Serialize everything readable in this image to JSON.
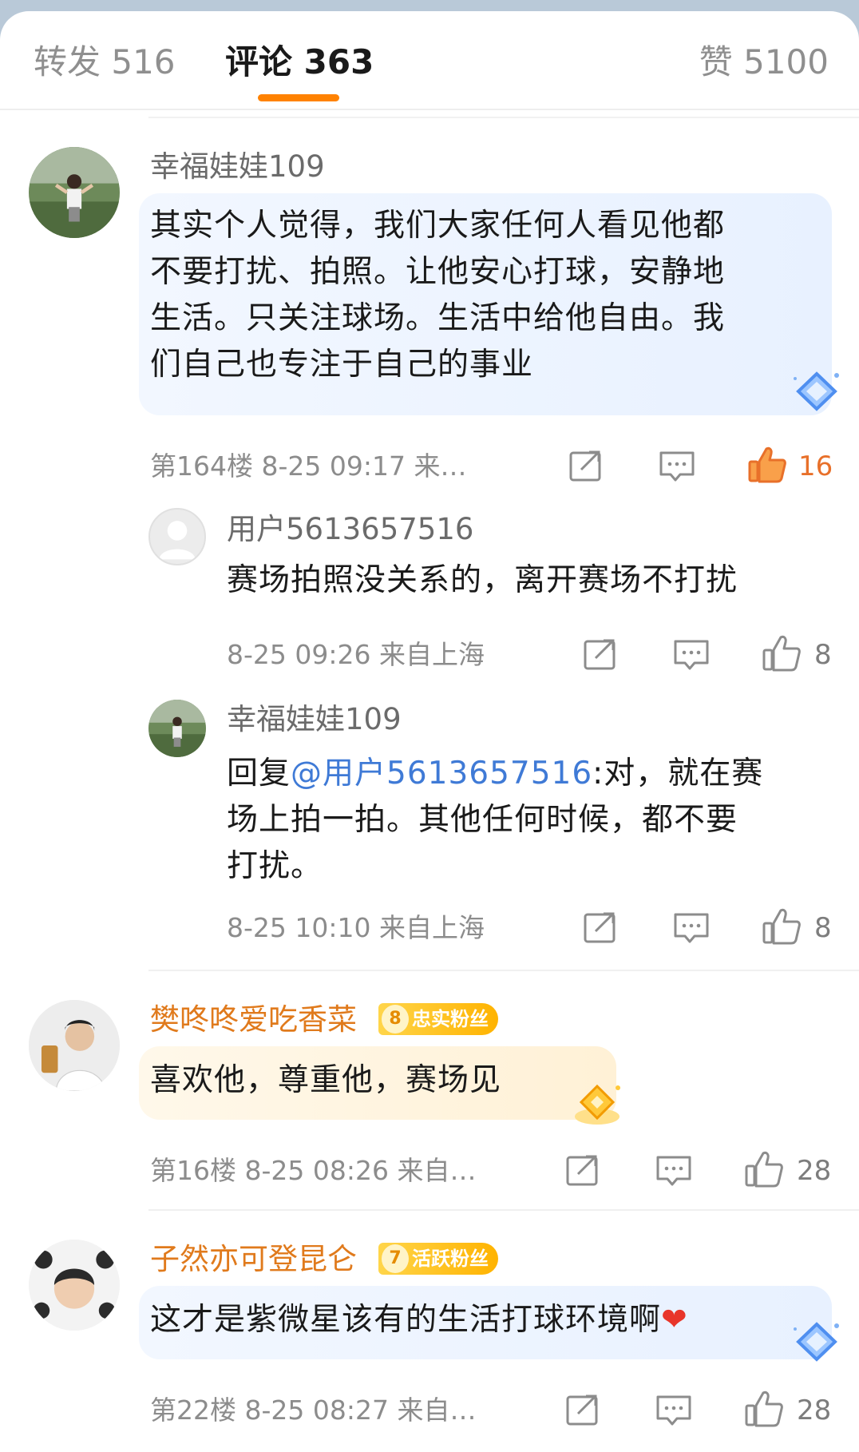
{
  "tabs": {
    "repost": "转发 516",
    "comments": "评论 363",
    "likes": "赞 5100"
  },
  "comments": [
    {
      "username": "幸福娃娃109",
      "text": [
        "其实个人觉得，我们大家任何人看见他都",
        "不要打扰、拍照。让他安心打球，安静地",
        "生活。只关注球场。生活中给他自由。我",
        "们自己也专注于自己的事业"
      ],
      "meta": "第164楼  8-25 09:17  来…",
      "likes": "16",
      "icons": [
        "share-icon",
        "comment-icon",
        "thumbs-up-icon"
      ]
    },
    {
      "username": "用户5613657516",
      "text": [
        "赛场拍照没关系的，离开赛场不打扰"
      ],
      "meta": "8-25 09:26  来自上海",
      "likes": "8"
    },
    {
      "username": "幸福娃娃109",
      "reply_prefix": "回复",
      "mention": "@用户5613657516",
      "text_first": ":对，就在赛",
      "text": [
        "场上拍一拍。其他任何时候，都不要",
        "打扰。"
      ],
      "meta": "8-25 10:10  来自上海",
      "likes": "8"
    },
    {
      "username": "樊咚咚爱吃香菜",
      "badge_level": "8",
      "badge_label": "忠实粉丝",
      "text": [
        "喜欢他，尊重他，赛场见"
      ],
      "meta": "第16楼  8-25 08:26  来自…",
      "likes": "28"
    },
    {
      "username": "子然亦可登昆仑",
      "badge_level": "7",
      "badge_label": "活跃粉丝",
      "text": [
        "这才是紫微星该有的生活打球环境啊"
      ],
      "meta": "第22楼  8-25 08:27  来自…",
      "likes": "28"
    }
  ],
  "colors": {
    "accent": "#ff8200",
    "mention": "#3f7ad6",
    "fan_name": "#e07a1c",
    "liked": "#e8702a"
  }
}
